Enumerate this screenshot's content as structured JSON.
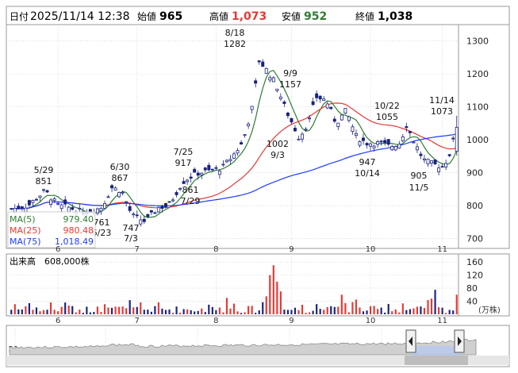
{
  "header": {
    "date_label": "日付",
    "date": "2025/11/14 12:38",
    "open_label": "始値",
    "open": "965",
    "high_label": "高値",
    "high": "1,073",
    "low_label": "安値",
    "low": "952",
    "close_label": "終値",
    "close": "1,038"
  },
  "colors": {
    "up": "#1a237e",
    "down": "#ffffff",
    "candle_stroke": "#1a237e",
    "ma5": "#2e7d32",
    "ma25": "#e53935",
    "ma75": "#1e3cff",
    "vol_up": "#e53935",
    "vol_down": "#1a237e",
    "grid": "#c8c8c8"
  },
  "legend": [
    {
      "key": "ma5",
      "label": "MA(5)",
      "value": "979.40",
      "color": "#2e7d32"
    },
    {
      "key": "ma25",
      "label": "MA(25)",
      "value": "980.48",
      "color": "#e53935"
    },
    {
      "key": "ma75",
      "label": "MA(75)",
      "value": "1,018.49",
      "color": "#1e3cff"
    }
  ],
  "volume": {
    "label": "出来高",
    "latest": "608,000株",
    "unit": "(万株)"
  },
  "price_axis": {
    "ticks": [
      "1300",
      "1200",
      "1100",
      "1000",
      "900",
      "800",
      "700"
    ],
    "values": [
      1300,
      1200,
      1100,
      1000,
      900,
      800,
      700
    ]
  },
  "volume_axis": {
    "ticks": [
      "160",
      "120",
      "80",
      "40"
    ],
    "values": [
      160,
      120,
      80,
      40
    ]
  },
  "month_labels": [
    "6",
    "7",
    "8",
    "9",
    "10",
    "11"
  ],
  "navigator_labels": [
    "21",
    "22",
    "23",
    "24",
    "25"
  ],
  "chart_data": {
    "type": "candlestick",
    "x_unit": "trading day index (Jun 2025 – Nov 14 2025)",
    "ylim": [
      680,
      1340
    ],
    "volume_ylim": [
      0,
      175
    ],
    "annotations": [
      {
        "date": "5/29",
        "value": "851"
      },
      {
        "date": "6/30",
        "value": "867"
      },
      {
        "date": "7/25",
        "value": "917"
      },
      {
        "date": "7/29",
        "value": "861"
      },
      {
        "date": "8/18",
        "value": "1282"
      },
      {
        "date": "9/9",
        "value": "1157"
      },
      {
        "date": "9/3",
        "value": "1002"
      },
      {
        "date": "10/22",
        "value": "1055"
      },
      {
        "date": "10/14",
        "value": "947"
      },
      {
        "date": "11/5",
        "value": "905"
      },
      {
        "date": "11/14",
        "value": "1073"
      },
      {
        "date": "6/23",
        "value": "761"
      },
      {
        "date": "7/3",
        "value": "747"
      }
    ]
  }
}
